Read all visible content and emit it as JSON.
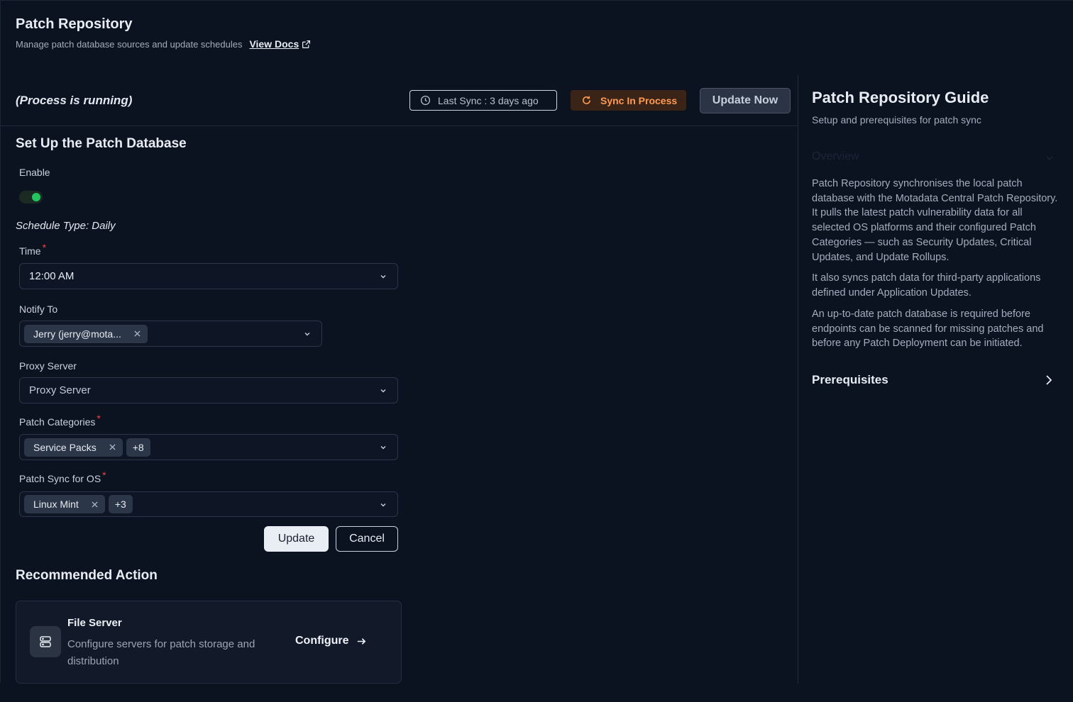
{
  "header": {
    "title": "Patch Repository",
    "subtitle": "Manage patch database sources and update schedules",
    "docs_link": "View Docs"
  },
  "status": {
    "running_text": "(Process is running)",
    "last_sync": "Last Sync : 3 days ago",
    "sync_status": "Sync In Process",
    "update_now": "Update Now",
    "sync_color": "#ff9a52"
  },
  "form": {
    "section_title": "Set Up the Patch Database",
    "enable_label": "Enable",
    "enabled": true,
    "schedule_type": "Schedule Type: Daily",
    "time_label": "Time",
    "time_value": "12:00 AM",
    "notify_label": "Notify To",
    "notify_chip": "Jerry (jerry@mota...",
    "proxy_label": "Proxy Server",
    "proxy_placeholder": "Proxy Server",
    "categories_label": "Patch Categories",
    "categories_chip": "Service Packs",
    "categories_more": "+8",
    "os_label": "Patch Sync for OS",
    "os_chip": "Linux Mint",
    "os_more": "+3",
    "update_button": "Update",
    "cancel_button": "Cancel"
  },
  "recommended": {
    "section_title": "Recommended Action",
    "card_title": "File Server",
    "card_desc": "Configure servers for patch storage and distribution",
    "card_cta": "Configure",
    "icon": "server-icon"
  },
  "guide": {
    "title": "Patch Repository Guide",
    "subtitle": "Setup and prerequisites for patch sync",
    "overview": "Overview",
    "paragraphs": [
      "Patch Repository synchronises the local patch database with the Motadata Central Patch Repository. It pulls the latest patch vulnerability data for all selected OS platforms and their configured Patch Categories — such as Security Updates, Critical Updates, and Update Rollups.",
      "It also syncs patch data for third-party applications defined under Application Updates.",
      "An up-to-date patch database is required before endpoints can be scanned for missing patches and before any Patch Deployment can be initiated."
    ],
    "prerequisites": "Prerequisites"
  }
}
